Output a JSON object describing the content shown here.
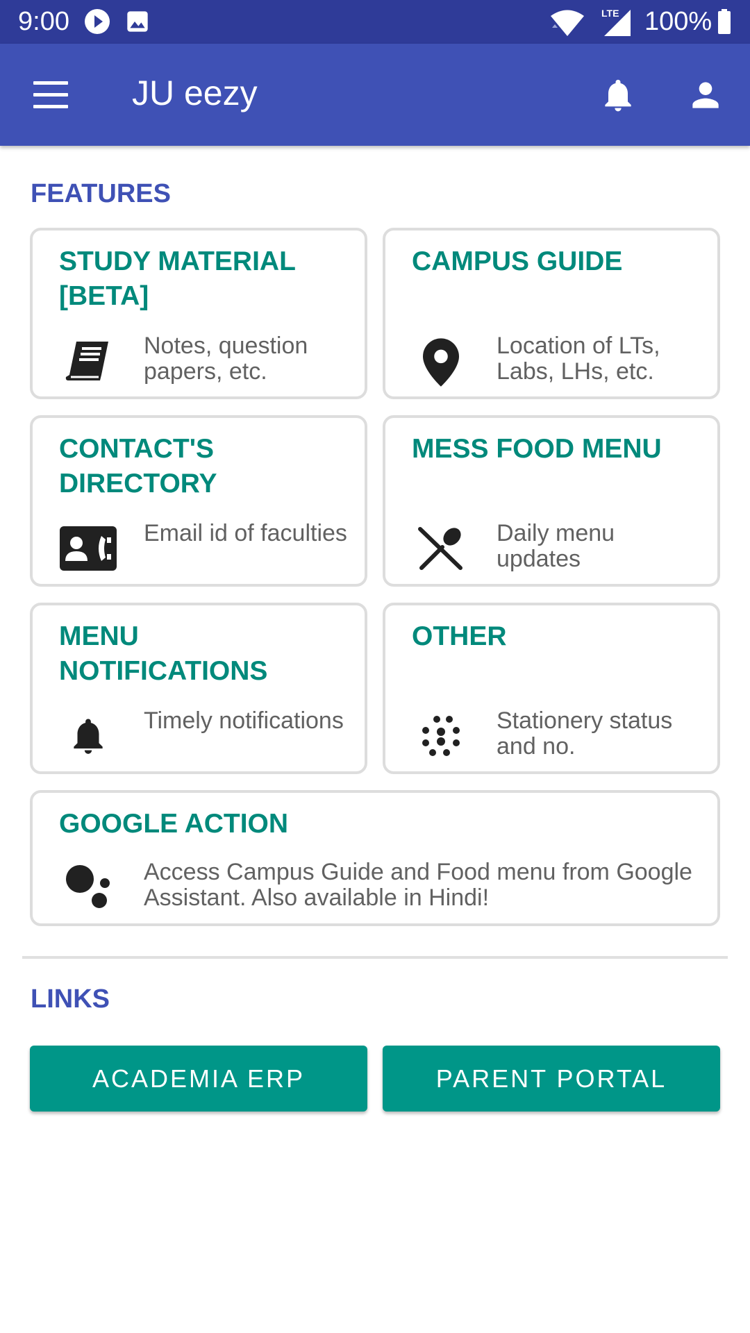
{
  "status_bar": {
    "time": "9:00",
    "network_label": "LTE",
    "battery": "100%"
  },
  "app_bar": {
    "title": "JU eezy"
  },
  "features": {
    "heading": "FEATURES",
    "cards": [
      {
        "title": "STUDY MATERIAL [BETA]",
        "description": "Notes, question papers, etc.",
        "icon": "book-icon"
      },
      {
        "title": "CAMPUS GUIDE",
        "description": "Location of LTs, Labs, LHs, etc.",
        "icon": "location-pin-icon"
      },
      {
        "title": "CONTACT'S DIRECTORY",
        "description": "Email id of faculties",
        "icon": "contact-card-icon"
      },
      {
        "title": "MESS FOOD MENU",
        "description": "Daily menu updates",
        "icon": "cutlery-icon"
      },
      {
        "title": "MENU NOTIFICATIONS",
        "description": "Timely notifications",
        "icon": "bell-icon"
      },
      {
        "title": "OTHER",
        "description": "Stationery status and no.",
        "icon": "dots-grid-icon"
      },
      {
        "title": "GOOGLE ACTION",
        "description": "Access Campus Guide and Food menu from Google Assistant. Also available in Hindi!",
        "icon": "google-assistant-icon"
      }
    ]
  },
  "links": {
    "heading": "LINKS",
    "buttons": [
      {
        "label": "ACADEMIA ERP"
      },
      {
        "label": "PARENT PORTAL"
      }
    ]
  },
  "colors": {
    "status_bar": "#2f3b98",
    "app_bar": "#3f51b5",
    "accent": "#00897b",
    "button": "#009688"
  }
}
